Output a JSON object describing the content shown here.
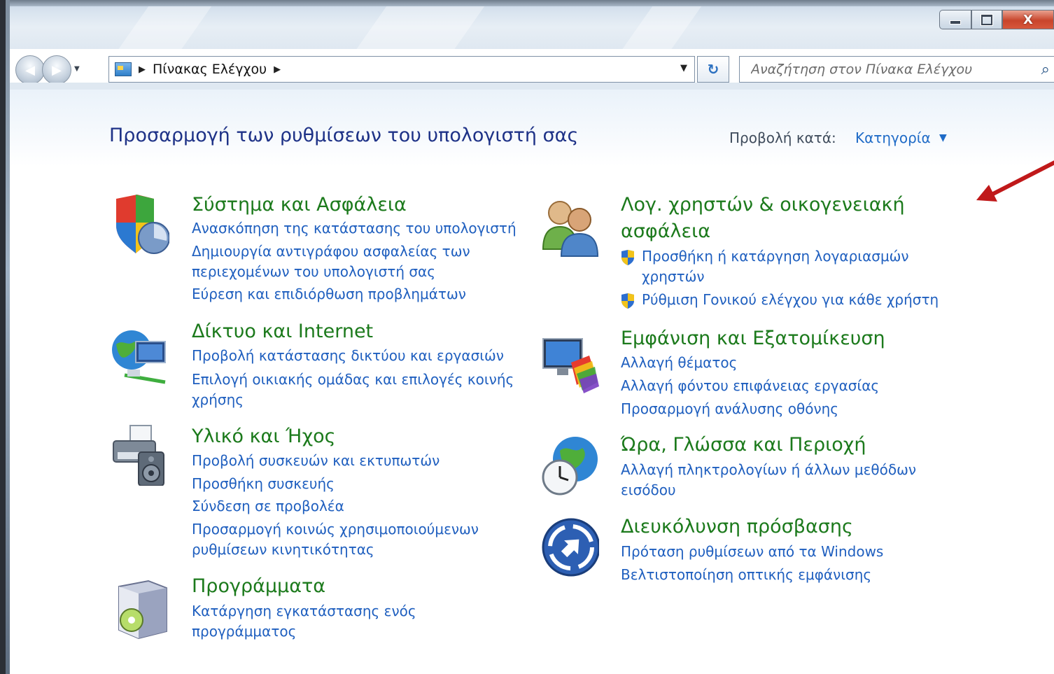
{
  "window": {
    "close_label": "X"
  },
  "address_bar": {
    "breadcrumb": "Πίνακας Ελέγχου"
  },
  "search": {
    "placeholder": "Αναζήτηση στον Πίνακα Ελέγχου"
  },
  "header": {
    "title": "Προσαρμογή των ρυθμίσεων του υπολογιστή σας",
    "view_by_label": "Προβολή κατά:",
    "view_by_value": "Κατηγορία"
  },
  "categories": {
    "system": {
      "title": "Σύστημα και Ασφάλεια",
      "links": [
        "Ανασκόπηση της κατάστασης του υπολογιστή",
        "Δημιουργία αντιγράφου ασφαλείας των",
        "περιεχομένων του υπολογιστή σας",
        "Εύρεση και επιδιόρθωση προβλημάτων"
      ]
    },
    "network": {
      "title": "Δίκτυο και Internet",
      "links": [
        "Προβολή κατάστασης δικτύου και εργασιών",
        "Επιλογή οικιακής ομάδας και επιλογές κοινής",
        "χρήσης"
      ]
    },
    "hardware": {
      "title": "Υλικό και Ήχος",
      "links": [
        "Προβολή συσκευών και εκτυπωτών",
        "Προσθήκη συσκευής",
        "Σύνδεση σε προβολέα",
        "Προσαρμογή κοινώς χρησιμοποιούμενων",
        "ρυθμίσεων κινητικότητας"
      ]
    },
    "programs": {
      "title": "Προγράμματα",
      "links": [
        "Κατάργηση εγκατάστασης ενός",
        "προγράμματος"
      ]
    },
    "users": {
      "title_line1": "Λογ. χρηστών & οικογενειακή",
      "title_line2": "ασφάλεια",
      "links": [
        "Προσθήκη ή κατάργηση λογαριασμών",
        "χρηστών",
        "Ρύθμιση Γονικού ελέγχου για κάθε χρήστη"
      ]
    },
    "appearance": {
      "title": "Εμφάνιση και Εξατομίκευση",
      "links": [
        "Αλλαγή θέματος",
        "Αλλαγή φόντου επιφάνειας εργασίας",
        "Προσαρμογή ανάλυσης οθόνης"
      ]
    },
    "clock": {
      "title": "Ώρα, Γλώσσα και Περιοχή",
      "links": [
        "Αλλαγή πληκτρολογίων ή άλλων μεθόδων",
        "εισόδου"
      ]
    },
    "ease": {
      "title": "Διευκόλυνση πρόσβασης",
      "links": [
        "Πρόταση ρυθμίσεων από τα Windows",
        "Βελτιστοποίηση οπτικής εμφάνισης"
      ]
    }
  },
  "colors": {
    "category_title": "#1c7a1c",
    "link": "#1f5fbf",
    "page_title": "#1e3287",
    "annotation_arrow": "#c0191a"
  }
}
